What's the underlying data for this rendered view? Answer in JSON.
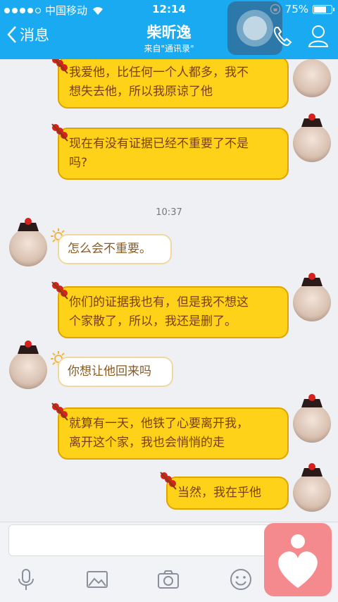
{
  "status": {
    "carrier": "中国移动",
    "time": "12:14",
    "battery_percent": "75%",
    "battery_level": 0.75
  },
  "header": {
    "back_label": "消息",
    "title": "柴昕逸",
    "subtitle": "来自\"通讯录\""
  },
  "messages": [
    {
      "side": "right",
      "lines": [
        "我爱他，比任何一个人都多，我不",
        "想失去他，所以我原谅了他"
      ]
    },
    {
      "side": "right",
      "lines": [
        "现在有没有证据已经不重要了不是",
        "吗?"
      ]
    },
    {
      "side": "time",
      "text": "10:37"
    },
    {
      "side": "left",
      "lines": [
        "怎么会不重要。"
      ]
    },
    {
      "side": "right",
      "lines": [
        "你们的证据我也有，但是我不想这",
        "个家散了，所以，我还是删了。"
      ]
    },
    {
      "side": "left",
      "lines": [
        "你想让他回来吗"
      ]
    },
    {
      "side": "right",
      "lines": [
        "就算有一天，他铁了心要离开我，",
        "离开这个家，我也会悄悄的走"
      ]
    },
    {
      "side": "right",
      "lines": [
        "当然，我在乎他"
      ]
    }
  ],
  "toolbar": {
    "icons": [
      "microphone-icon",
      "image-icon",
      "camera-icon",
      "emoji-icon",
      "plus-icon"
    ]
  },
  "colors": {
    "accent": "#1aaaf1",
    "bubble_right": "#ffd21a",
    "float_button": "#f58a8e"
  }
}
